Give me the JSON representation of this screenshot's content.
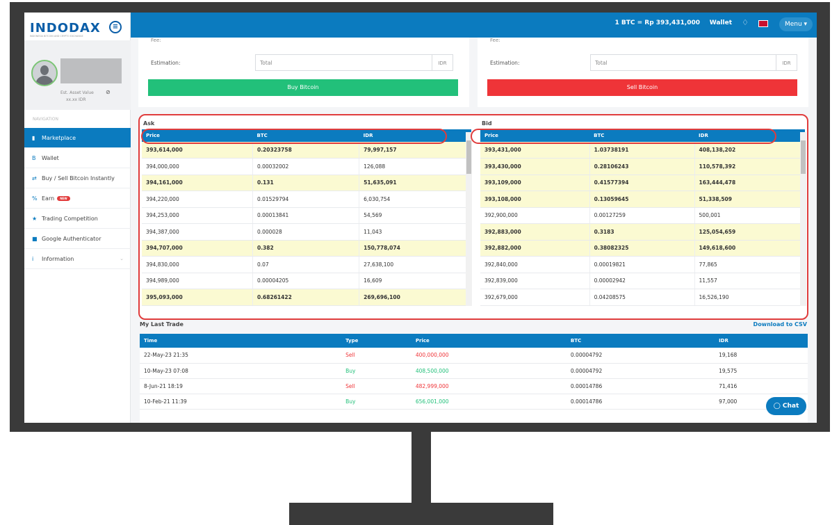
{
  "brand": {
    "logo_text": "INDODAX",
    "tagline": "INDONESIA BITCOIN AND CRYPTO EXCHANGE"
  },
  "header": {
    "rate": "1 BTC = Rp 393,431,000",
    "wallet_label": "Wallet",
    "menu_label": "Menu ▾"
  },
  "user": {
    "asset_label": "Est. Asset Value",
    "asset_value": "xx.xx IDR"
  },
  "nav": {
    "title": "NAVIGATION",
    "items": [
      {
        "label": "Marketplace",
        "icon": "chart-icon"
      },
      {
        "label": "Wallet",
        "icon": "bitcoin-icon"
      },
      {
        "label": "Buy / Sell Bitcoin Instantly",
        "icon": "exchange-icon"
      },
      {
        "label": "Earn",
        "icon": "percent-icon",
        "badge": "NEW"
      },
      {
        "label": "Trading Competition",
        "icon": "trophy-icon"
      },
      {
        "label": "Google Authenticator",
        "icon": "lock-icon"
      },
      {
        "label": "Information",
        "icon": "info-icon"
      }
    ]
  },
  "buy_form": {
    "fee_label": "Fee:",
    "estimation_label": "Estimation:",
    "placeholder": "Total",
    "unit": "IDR",
    "button": "Buy Bitcoin"
  },
  "sell_form": {
    "fee_label": "Fee:",
    "estimation_label": "Estimation:",
    "placeholder": "Total",
    "unit": "IDR",
    "button": "Sell Bitcoin"
  },
  "ask": {
    "title": "Ask",
    "headers": [
      "Price",
      "BTC",
      "IDR"
    ],
    "rows": [
      {
        "price": "393,614,000",
        "btc": "0.20323758",
        "idr": "79,997,157",
        "hl": true
      },
      {
        "price": "394,000,000",
        "btc": "0.00032002",
        "idr": "126,088",
        "hl": false
      },
      {
        "price": "394,161,000",
        "btc": "0.131",
        "idr": "51,635,091",
        "hl": true
      },
      {
        "price": "394,220,000",
        "btc": "0.01529794",
        "idr": "6,030,754",
        "hl": false
      },
      {
        "price": "394,253,000",
        "btc": "0.00013841",
        "idr": "54,569",
        "hl": false
      },
      {
        "price": "394,387,000",
        "btc": "0.000028",
        "idr": "11,043",
        "hl": false
      },
      {
        "price": "394,707,000",
        "btc": "0.382",
        "idr": "150,778,074",
        "hl": true
      },
      {
        "price": "394,830,000",
        "btc": "0.07",
        "idr": "27,638,100",
        "hl": false
      },
      {
        "price": "394,989,000",
        "btc": "0.00004205",
        "idr": "16,609",
        "hl": false
      },
      {
        "price": "395,093,000",
        "btc": "0.68261422",
        "idr": "269,696,100",
        "hl": true
      }
    ]
  },
  "bid": {
    "title": "Bid",
    "headers": [
      "Price",
      "BTC",
      "IDR"
    ],
    "rows": [
      {
        "price": "393,431,000",
        "btc": "1.03738191",
        "idr": "408,138,202",
        "hl": true
      },
      {
        "price": "393,430,000",
        "btc": "0.28106243",
        "idr": "110,578,392",
        "hl": true
      },
      {
        "price": "393,109,000",
        "btc": "0.41577394",
        "idr": "163,444,478",
        "hl": true
      },
      {
        "price": "393,108,000",
        "btc": "0.13059645",
        "idr": "51,338,509",
        "hl": true
      },
      {
        "price": "392,900,000",
        "btc": "0.00127259",
        "idr": "500,001",
        "hl": false
      },
      {
        "price": "392,883,000",
        "btc": "0.3183",
        "idr": "125,054,659",
        "hl": true
      },
      {
        "price": "392,882,000",
        "btc": "0.38082325",
        "idr": "149,618,600",
        "hl": true
      },
      {
        "price": "392,840,000",
        "btc": "0.00019821",
        "idr": "77,865",
        "hl": false
      },
      {
        "price": "392,839,000",
        "btc": "0.00002942",
        "idr": "11,557",
        "hl": false
      },
      {
        "price": "392,679,000",
        "btc": "0.04208575",
        "idr": "16,526,190",
        "hl": false
      }
    ]
  },
  "last_trade": {
    "title": "My Last Trade",
    "download_label": "Download to CSV",
    "headers": [
      "Time",
      "Type",
      "Price",
      "BTC",
      "IDR"
    ],
    "rows": [
      {
        "time": "22-May-23 21:35",
        "type": "Sell",
        "price": "400,000,000",
        "btc": "0.00004792",
        "idr": "19,168"
      },
      {
        "time": "10-May-23 07:08",
        "type": "Buy",
        "price": "408,500,000",
        "btc": "0.00004792",
        "idr": "19,575"
      },
      {
        "time": "8-Jun-21 18:19",
        "type": "Sell",
        "price": "482,999,000",
        "btc": "0.00014786",
        "idr": "71,416"
      },
      {
        "time": "10-Feb-21 11:39",
        "type": "Buy",
        "price": "656,001,000",
        "btc": "0.00014786",
        "idr": "97,000"
      }
    ]
  },
  "chat_label": "Chat",
  "colors": {
    "primary": "#0b7bbf",
    "buy": "#22c07a",
    "sell": "#ef3438",
    "highlight_row": "#fbfad2",
    "annotation": "#e03c3c"
  }
}
